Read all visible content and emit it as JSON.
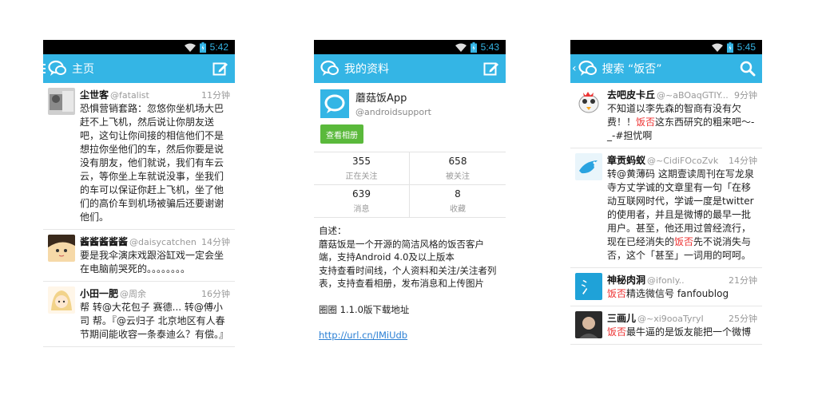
{
  "colors": {
    "accent": "#34b5e5",
    "highlight": "#ee3333",
    "album_button": "#5ab93b"
  },
  "screens": [
    {
      "status_time": "5:42",
      "title": "主页",
      "action_icon": "compose-icon",
      "tweets": [
        {
          "name": "尘世客",
          "handle": "@fatalist",
          "time": "11分钟",
          "text": "恐惧营销套路：忽悠你坐机场大巴赶不上飞机，然后说让你朋友送吧，这句让你间接的相信他们不是想拉你坐他们的车，然后你要是说没有朋友，他们就说，我们有车云云，等你坐上车就说没事，坐我们的车可以保证你赶上飞机，坐了他们的高价车到机场被骗后还要谢谢他们。"
        },
        {
          "name": "酱酱酱酱酱",
          "handle": "@daisycatchen",
          "time": "14分钟",
          "text": "要是我伞演床戏跟浴缸戏一定会坐在电脑前哭死的。。。。。。。。"
        },
        {
          "name": "小田一肥",
          "handle": "@周余",
          "time": "16分钟",
          "text": "帮 转@大花包子 赛德... 转@傅小司 帮。『@云归子 北京地区有人春节期间能收容一条泰迪么？有偿。』"
        }
      ]
    },
    {
      "status_time": "5:43",
      "title": "我的资料",
      "action_icon": "compose-icon",
      "profile": {
        "name": "蘑菇饭App",
        "handle": "@androidsupport",
        "album_button": "查看相册",
        "stats": [
          {
            "num": "355",
            "label": "正在关注"
          },
          {
            "num": "658",
            "label": "被关注"
          },
          {
            "num": "639",
            "label": "消息"
          },
          {
            "num": "8",
            "label": "收藏"
          }
        ],
        "desc_label": "自述：",
        "desc_line1": "蘑菇饭是一个开源的简洁风格的饭否客户端，支持Android 4.0及以上版本",
        "desc_line2": "支持查看时间线，个人资料和关注/关注者列表，支持查看相册，发布消息和上传图片",
        "desc_line3": "圈圈 1.1.0版下载地址",
        "desc_link": "http://url.cn/IMiUdb"
      }
    },
    {
      "status_time": "5:45",
      "title": "搜索 “饭否”",
      "action_icon": "search-icon",
      "results": [
        {
          "name": "去吧皮卡丘",
          "handle": "@~aBOaqGTIY...",
          "time": "9分钟",
          "pre": "不知道以李先森的智商有没有欠费！！",
          "hl": "饭否",
          "post": "这东西研究的粗来吧～-_-#担忧啊"
        },
        {
          "name": "章贡蚂蚁",
          "handle": "@~CidiFOcoZvk",
          "time": "14分钟",
          "pre": "转@黄薄码 这期壹读周刊在写龙泉寺方丈学诚的文章里有一句「在移动互联网时代，学诚一度是twitter的使用者，并且是微博的最早一批用户。甚至，他还用过曾经流行，现在已经消失的",
          "hl": "饭否",
          "post": "先不说消失与否，这个「甚至」一词用的呵呵。"
        },
        {
          "name": "神秘肉洞",
          "handle": "@ifonly..",
          "time": "21分钟",
          "pre": "",
          "hl": "饭否",
          "post": "精选微信号 fanfoublog"
        },
        {
          "name": "三画儿",
          "handle": "@~xi9ooaTyryI",
          "time": "25分钟",
          "pre": "",
          "hl": "饭否",
          "post": "最牛逼的是饭友能把一个微博"
        }
      ]
    }
  ]
}
